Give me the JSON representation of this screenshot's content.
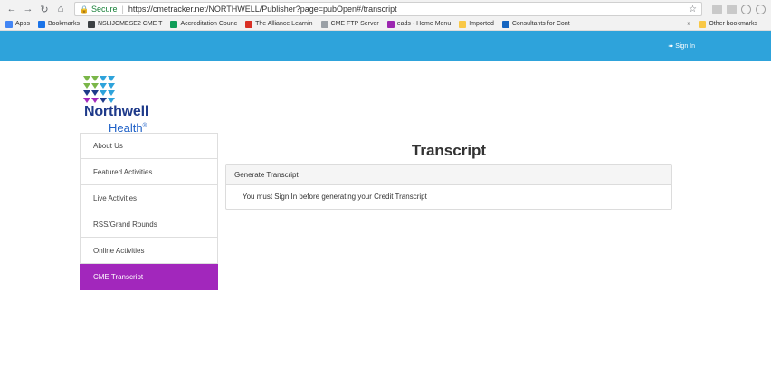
{
  "browser": {
    "secure_label": "Secure",
    "url": "https://cmetracker.net/NORTHWELL/Publisher?page=pubOpen#/transcript",
    "bookmarks": [
      {
        "label": "Apps",
        "color": "#4285f4"
      },
      {
        "label": "Bookmarks",
        "color": "#1a73e8"
      },
      {
        "label": "NSLIJCMESE2 CME T",
        "color": "#3c4043"
      },
      {
        "label": "Accreditation Counc",
        "color": "#0f9d58"
      },
      {
        "label": "The Alliance Learnin",
        "color": "#d93025"
      },
      {
        "label": "CME FTP Server",
        "color": "#9aa0a6"
      },
      {
        "label": "eads - Home Menu",
        "color": "#9c27b0"
      },
      {
        "label": "Imported",
        "color": "#f9c846"
      },
      {
        "label": "Consultants for Cont",
        "color": "#1565c0"
      }
    ],
    "other_bookmarks": "Other bookmarks",
    "more": "»"
  },
  "header": {
    "bar_color": "#2ea3db",
    "sign_in": "Sign In"
  },
  "logo": {
    "brand": "Northwell",
    "brand2": "Health",
    "mark": "®",
    "colors": [
      "#7ab648",
      "#2ea3db",
      "#1e3a8a",
      "#a227bc"
    ]
  },
  "sidebar": {
    "active_color": "#a227bc",
    "items": [
      {
        "label": "About Us"
      },
      {
        "label": "Featured Activities"
      },
      {
        "label": "Live Activities"
      },
      {
        "label": "RSS/Grand Rounds"
      },
      {
        "label": "Online Activities"
      },
      {
        "label": "CME Transcript",
        "active": true
      }
    ]
  },
  "main": {
    "title": "Transcript",
    "panel": {
      "heading": "Generate Transcript",
      "message": "You must Sign In before generating your Credit Transcript"
    }
  }
}
